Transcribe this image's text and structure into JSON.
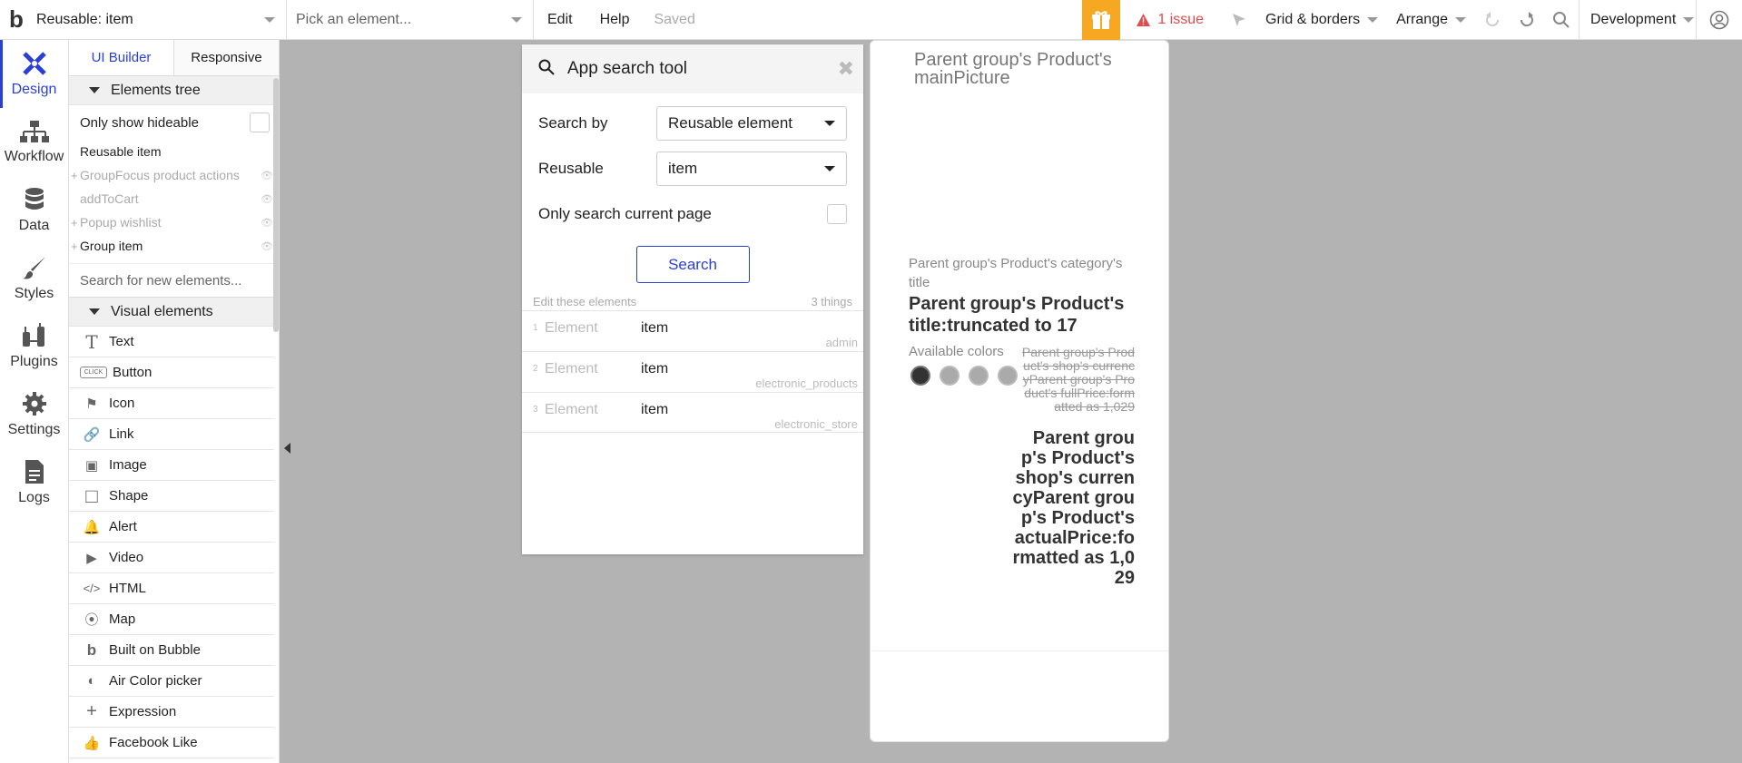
{
  "topbar": {
    "logo": "b",
    "reusable_select": "Reusable: item",
    "element_placeholder": "Pick an element...",
    "edit": "Edit",
    "help": "Help",
    "saved": "Saved",
    "issue": "1 issue",
    "grid": "Grid & borders",
    "arrange": "Arrange",
    "env": "Development"
  },
  "rail": {
    "items": [
      {
        "label": "Design",
        "icon": "design-icon"
      },
      {
        "label": "Workflow",
        "icon": "workflow-icon"
      },
      {
        "label": "Data",
        "icon": "database-icon"
      },
      {
        "label": "Styles",
        "icon": "brush-icon"
      },
      {
        "label": "Plugins",
        "icon": "plugin-icon"
      },
      {
        "label": "Settings",
        "icon": "gear-icon"
      },
      {
        "label": "Logs",
        "icon": "logs-icon"
      }
    ]
  },
  "panel": {
    "tabs": [
      "UI Builder",
      "Responsive"
    ],
    "elements_tree": "Elements tree",
    "only_hideable": "Only show hideable",
    "tree": [
      "Reusable item",
      "GroupFocus product actions",
      "addToCart",
      "Popup wishlist",
      "Group item"
    ],
    "search_placeholder": "Search for new elements...",
    "visual_elements": "Visual elements",
    "visual": [
      {
        "label": "Text",
        "icon": "T"
      },
      {
        "label": "Button",
        "icon": "CLICK"
      },
      {
        "label": "Icon",
        "icon": "⚑"
      },
      {
        "label": "Link",
        "icon": "🔗"
      },
      {
        "label": "Image",
        "icon": "▣"
      },
      {
        "label": "Shape",
        "icon": "□"
      },
      {
        "label": "Alert",
        "icon": "🔔"
      },
      {
        "label": "Video",
        "icon": "▶"
      },
      {
        "label": "HTML",
        "icon": "</>"
      },
      {
        "label": "Map",
        "icon": "⦿"
      },
      {
        "label": "Built on Bubble",
        "icon": "b"
      },
      {
        "label": "Air Color picker",
        "icon": "◐"
      },
      {
        "label": "Expression",
        "icon": "+"
      },
      {
        "label": "Facebook Like",
        "icon": "👍"
      }
    ]
  },
  "search_tool": {
    "title": "App search tool",
    "search_by_label": "Search by",
    "search_by_value": "Reusable element",
    "reusable_label": "Reusable",
    "reusable_value": "item",
    "only_current_page": "Only search current page",
    "search_button": "Search",
    "edit_elements": "Edit these elements",
    "count": "3 things",
    "results": [
      {
        "num": "1",
        "label": "Element",
        "value": "item",
        "app": "admin"
      },
      {
        "num": "2",
        "label": "Element",
        "value": "item",
        "app": "electronic_products"
      },
      {
        "num": "3",
        "label": "Element",
        "value": "item",
        "app": "electronic_store"
      }
    ]
  },
  "canvas": {
    "main_picture": "Parent group's Product's mainPicture",
    "category_title": "Parent group's Product's category's title",
    "product_title": "Parent group's Product's title:truncated to 17",
    "available_colors": "Available colors",
    "full_price": "Parent group's Product's shop's currencyParent group's Product's fullPrice:formatted as 1,029",
    "actual_price": "Parent group's Product's shop's currencyParent group's Product's actualPrice:formatted as 1,029"
  },
  "colors": {
    "accent": "#2a3fd5",
    "gift": "#f7a823",
    "issue": "#e04b4b",
    "canvas_bg": "#b3b3b3"
  }
}
